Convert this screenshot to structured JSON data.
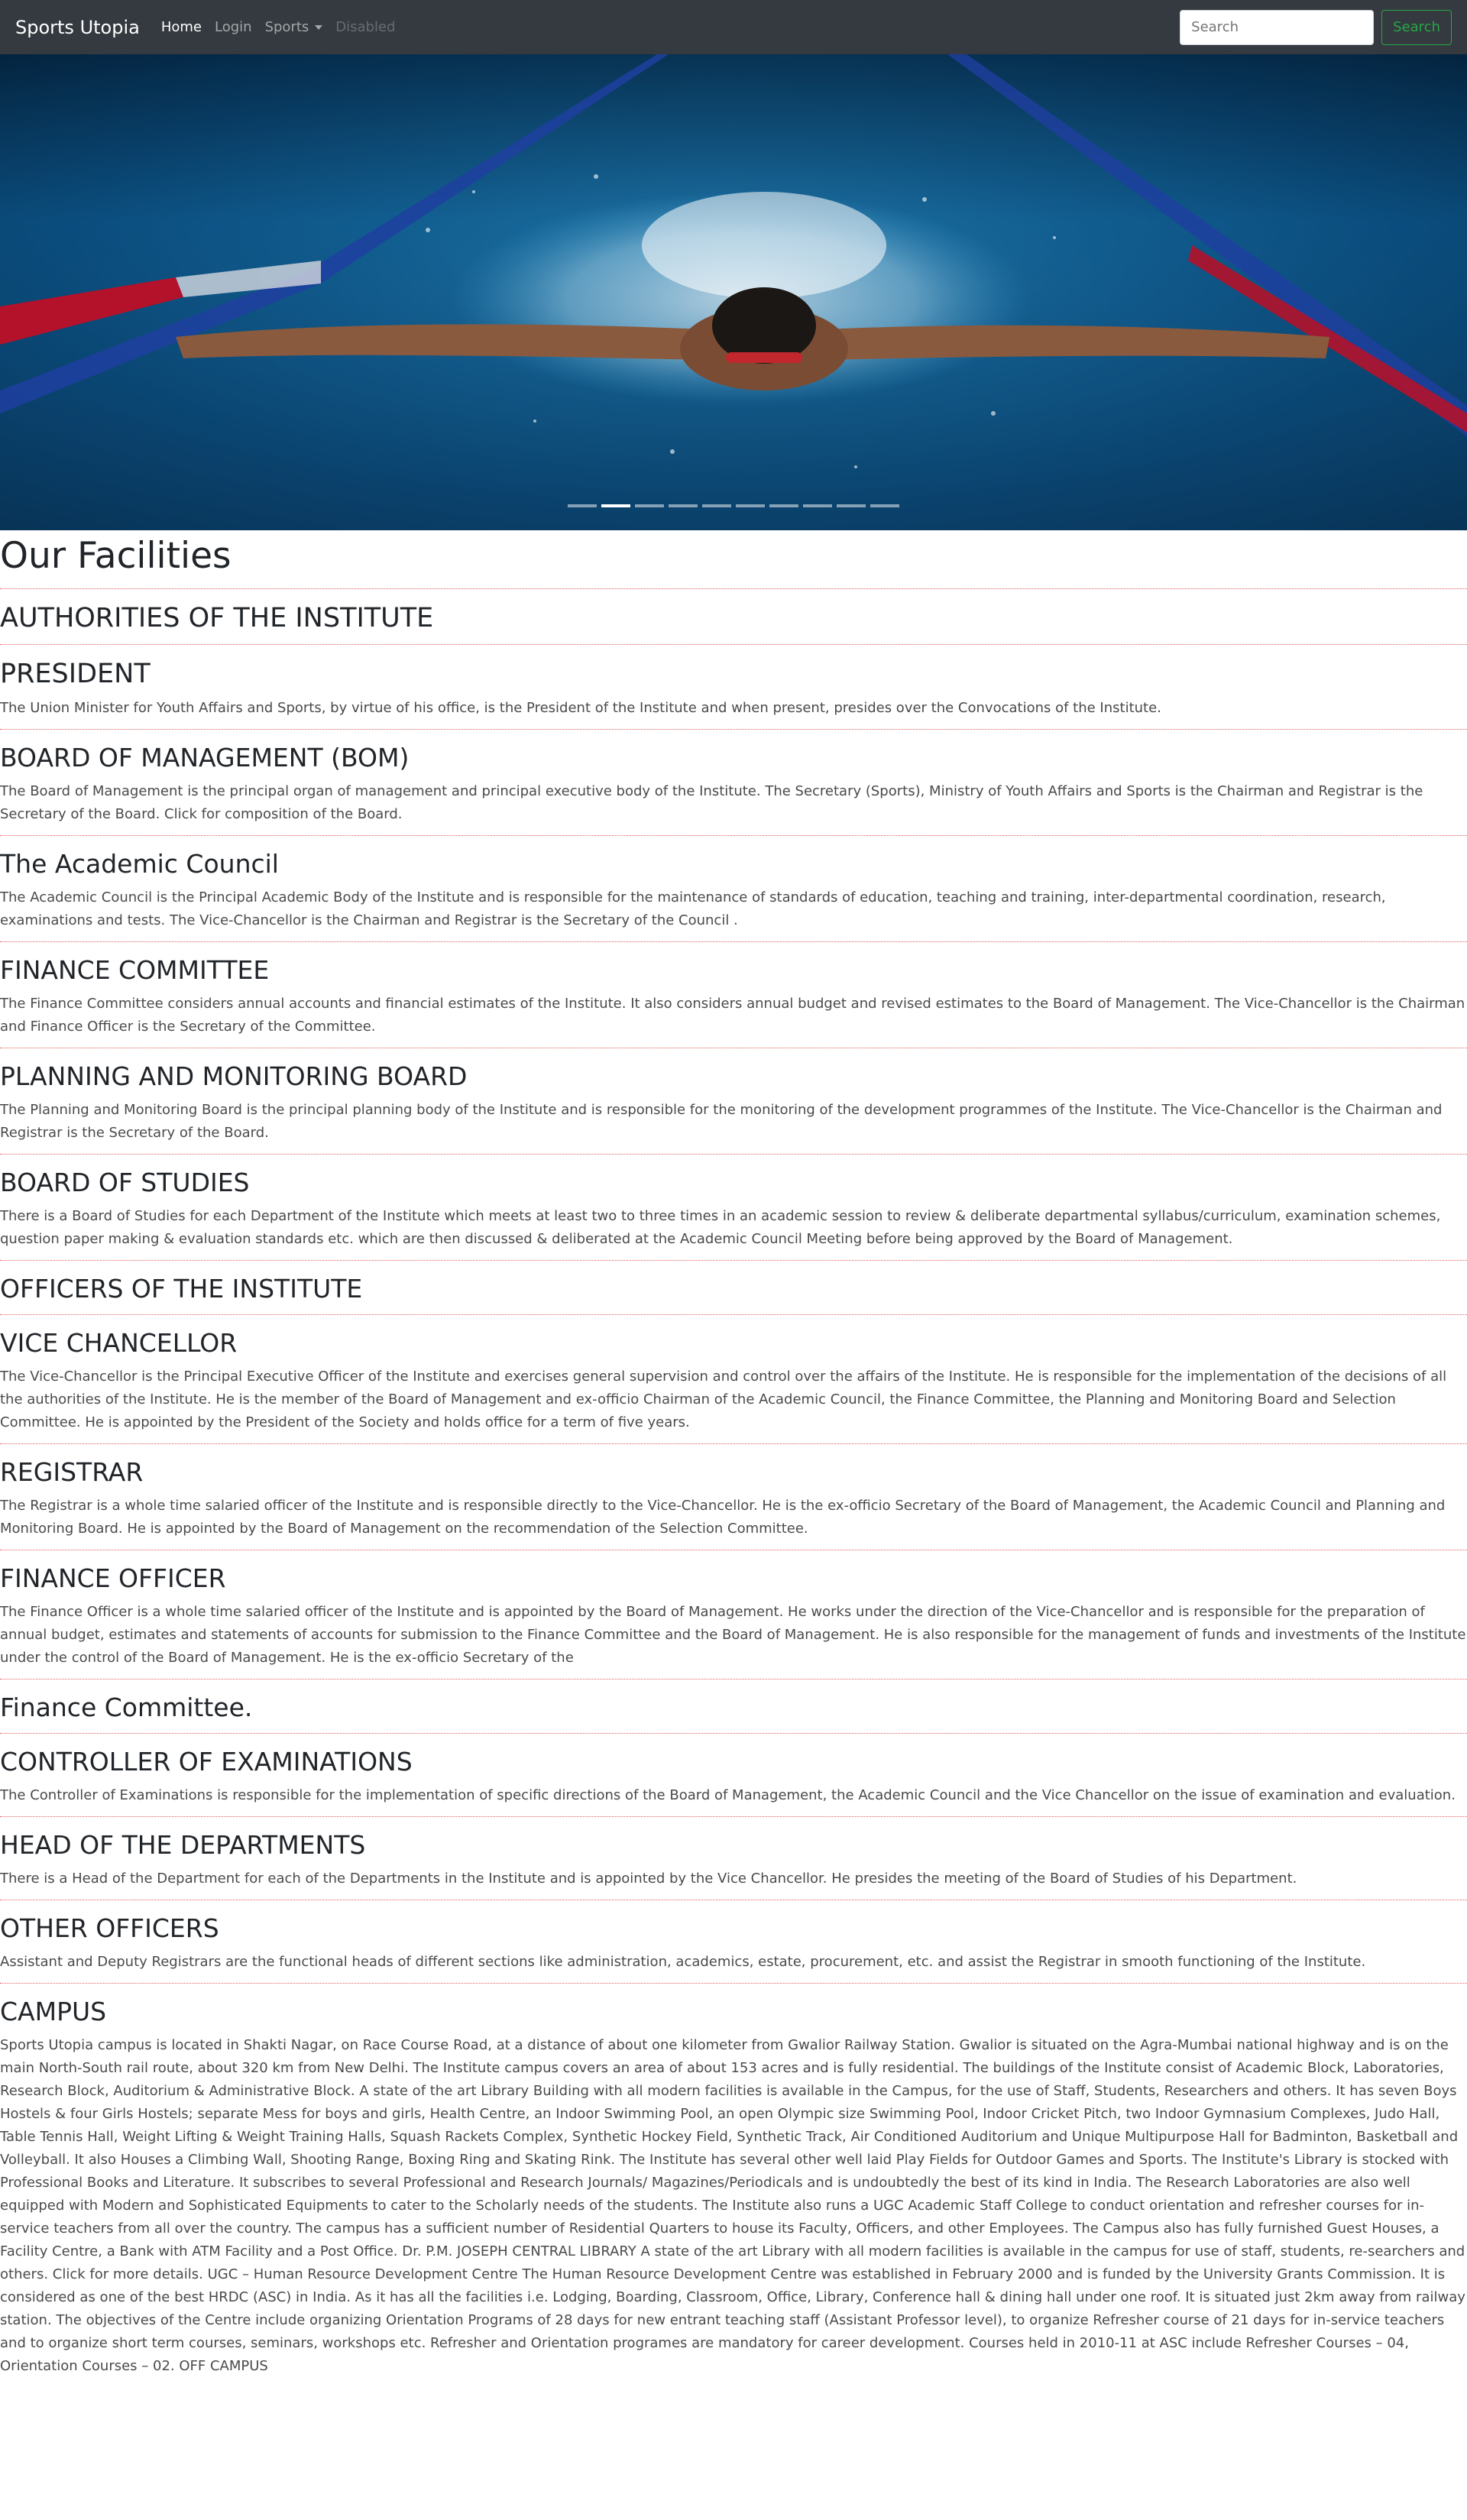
{
  "navbar": {
    "brand": "Sports Utopia",
    "links": [
      {
        "label": "Home"
      },
      {
        "label": "Login"
      },
      {
        "label": "Sports"
      },
      {
        "label": "Disabled"
      }
    ],
    "search": {
      "placeholder": "Search",
      "button": "Search"
    }
  },
  "carousel": {
    "indicator_count": 10,
    "active_index": 1
  },
  "page": {
    "title": "Our Facilities",
    "sections": [
      {
        "heading": "AUTHORITIES OF THE INSTITUTE",
        "text": ""
      },
      {
        "heading": "PRESIDENT",
        "text": "The Union Minister for Youth Affairs and Sports, by virtue of his office, is the President of the Institute and when present, presides over the Convocations of the Institute."
      },
      {
        "heading": "BOARD OF MANAGEMENT (BOM)",
        "text": "The Board of Management is the principal organ of management and principal executive body of the Institute. The Secretary (Sports), Ministry of Youth Affairs and Sports is the Chairman and Registrar is the Secretary of the Board. Click for composition of the Board."
      },
      {
        "heading": "The Academic Council",
        "text": "The Academic Council is the Principal Academic Body of the Institute and is responsible for the maintenance of standards of education, teaching and training, inter-departmental coordination, research, examinations and tests. The Vice-Chancellor is the Chairman and Registrar is the Secretary of the Council ."
      },
      {
        "heading": "FINANCE COMMITTEE",
        "text": "The Finance Committee considers annual accounts and financial estimates of the Institute. It also considers annual budget and revised estimates to the Board of Management. The Vice-Chancellor is the Chairman and Finance Officer is the Secretary of the Committee."
      },
      {
        "heading": "PLANNING AND MONITORING BOARD",
        "text": "The Planning and Monitoring Board is the principal planning body of the Institute and is responsible for the monitoring of the development programmes of the Institute. The Vice-Chancellor is the Chairman and Registrar is the Secretary of the Board."
      },
      {
        "heading": "BOARD OF STUDIES",
        "text": "There is a Board of Studies for each Department of the Institute which meets at least two to three times in an academic session to review & deliberate departmental syllabus/curriculum, examination schemes, question paper making & evaluation standards etc. which are then discussed & deliberated at the Academic Council Meeting before being approved by the Board of Management."
      },
      {
        "heading": "OFFICERS OF THE INSTITUTE",
        "text": ""
      },
      {
        "heading": "VICE CHANCELLOR",
        "text": "The Vice-Chancellor is the Principal Executive Officer of the Institute and exercises general supervision and control over the affairs of the Institute. He is responsible for the implementation of the decisions of all the authorities of the Institute. He is the member of the Board of Management and ex-officio Chairman of the Academic Council, the Finance Committee, the Planning and Monitoring Board and Selection Committee. He is appointed by the President of the Society and holds office for a term of five years."
      },
      {
        "heading": "REGISTRAR",
        "text": "The Registrar is a whole time salaried officer of the Institute and is responsible directly to the Vice-Chancellor. He is the ex-officio Secretary of the Board of Management, the Academic Council and Planning and Monitoring Board. He is appointed by the Board of Management on the recommendation of the Selection Committee."
      },
      {
        "heading": "FINANCE OFFICER",
        "text": "The Finance Officer is a whole time salaried officer of the Institute and is appointed by the Board of Management. He works under the direction of the Vice-Chancellor and is responsible for the preparation of annual budget, estimates and statements of accounts for submission to the Finance Committee and the Board of Management. He is also responsible for the management of funds and investments of the Institute under the control of the Board of Management. He is the ex-officio Secretary of the"
      },
      {
        "heading": "Finance Committee.",
        "text": ""
      },
      {
        "heading": "CONTROLLER OF EXAMINATIONS",
        "text": "The Controller of Examinations is responsible for the implementation of specific directions of the Board of Management, the Academic Council and the Vice Chancellor on the issue of examination and evaluation."
      },
      {
        "heading": "HEAD OF THE DEPARTMENTS",
        "text": "There is a Head of the Department for each of the Departments in the Institute and is appointed by the Vice Chancellor. He presides the meeting of the Board of Studies of his Department."
      },
      {
        "heading": "OTHER OFFICERS",
        "text": "Assistant and Deputy Registrars are the functional heads of different sections like administration, academics, estate, procurement, etc. and assist the Registrar in smooth functioning of the Institute."
      },
      {
        "heading": "CAMPUS",
        "text": "Sports Utopia campus is located in Shakti Nagar, on Race Course Road, at a distance of about one kilometer from Gwalior Railway Station. Gwalior is situated on the Agra-Mumbai national highway and is on the main North-South rail route, about 320 km from New Delhi. The Institute campus covers an area of about 153 acres and is fully residential. The buildings of the Institute consist of Academic Block, Laboratories, Research Block, Auditorium & Administrative Block. A state of the art Library Building with all modern facilities is available in the Campus, for the use of Staff, Students, Researchers and others. It has seven Boys Hostels & four Girls Hostels; separate Mess for boys and girls, Health Centre, an Indoor Swimming Pool, an open Olympic size Swimming Pool, Indoor Cricket Pitch, two Indoor Gymnasium Complexes, Judo Hall, Table Tennis Hall, Weight Lifting & Weight Training Halls, Squash Rackets Complex, Synthetic Hockey Field, Synthetic Track, Air Conditioned Auditorium and Unique Multipurpose Hall for Badminton, Basketball and Volleyball. It also Houses a Climbing Wall, Shooting Range, Boxing Ring and Skating Rink. The Institute has several other well laid Play Fields for Outdoor Games and Sports. The Institute's Library is stocked with Professional Books and Literature. It subscribes to several Professional and Research Journals/ Magazines/Periodicals and is undoubtedly the best of its kind in India. The Research Laboratories are also well equipped with Modern and Sophisticated Equipments to cater to the Scholarly needs of the students. The Institute also runs a UGC Academic Staff College to conduct orientation and refresher courses for in-service teachers from all over the country. The campus has a sufficient number of Residential Quarters to house its Faculty, Officers, and other Employees. The Campus also has fully furnished Guest Houses, a Facility Centre, a Bank with ATM Facility and a Post Office. Dr. P.M. JOSEPH CENTRAL LIBRARY A state of the art Library with all modern facilities is available in the campus for use of staff, students, re-searchers and others. Click for more details. UGC – Human Resource Development Centre The Human Resource Development Centre was established in February 2000 and is funded by the University Grants Commission. It is considered as one of the best HRDC (ASC) in India. As it has all the facilities i.e. Lodging, Boarding, Classroom, Office, Library, Conference hall & dining hall under one roof. It is situated just 2km away from railway station. The objectives of the Centre include organizing Orientation Programs of 28 days for new entrant teaching staff (Assistant Professor level), to organize Refresher course of 21 days for in-service teachers and to organize short term courses, seminars, workshops etc. Refresher and Orientation programes are mandatory for career development. Courses held in 2010-11 at ASC include Refresher Courses – 04, Orientation Courses – 02. OFF CAMPUS"
      }
    ]
  },
  "colors": {
    "navbar": "#343a40",
    "success": "#28a745",
    "separator": "#e06060"
  }
}
